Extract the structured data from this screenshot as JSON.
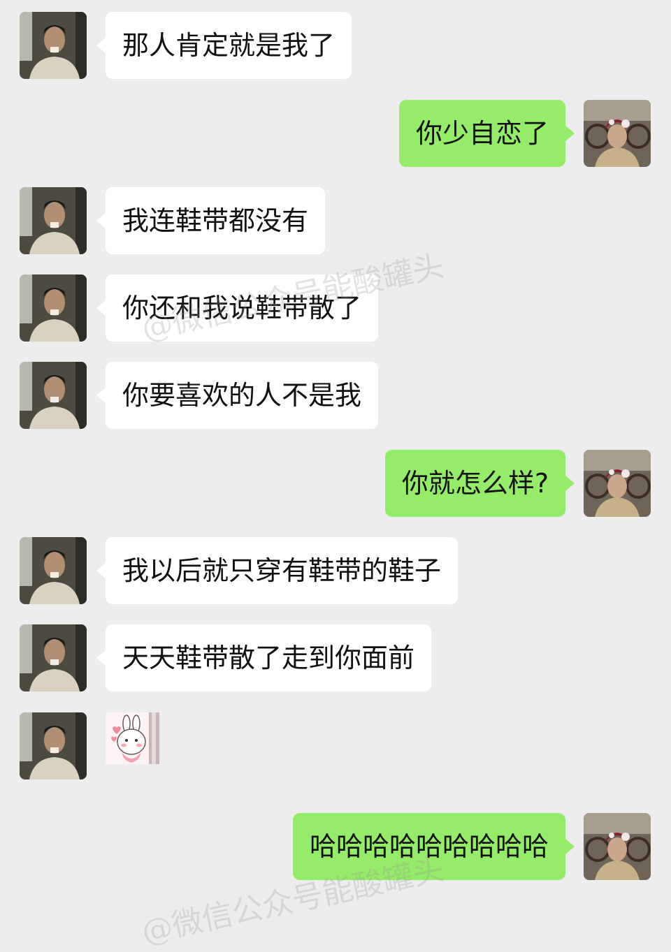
{
  "messages": [
    {
      "side": "left",
      "text": "那人肯定就是我了"
    },
    {
      "side": "right",
      "text": "你少自恋了"
    },
    {
      "side": "left",
      "text": "我连鞋带都没有"
    },
    {
      "side": "left",
      "text": "你还和我说鞋带散了"
    },
    {
      "side": "left",
      "text": "你要喜欢的人不是我"
    },
    {
      "side": "right",
      "text": "你就怎么样?"
    },
    {
      "side": "left",
      "text": "我以后就只穿有鞋带的鞋子"
    },
    {
      "side": "left",
      "text": "天天鞋带散了走到你面前"
    },
    {
      "side": "left",
      "sticker": "bunny-sticker"
    },
    {
      "side": "right",
      "text": "哈哈哈哈哈哈哈哈哈"
    }
  ],
  "watermark": "@微信公众号能酸罐头",
  "colors": {
    "background": "#ededed",
    "left_bubble": "#ffffff",
    "right_bubble": "#95ec69"
  }
}
